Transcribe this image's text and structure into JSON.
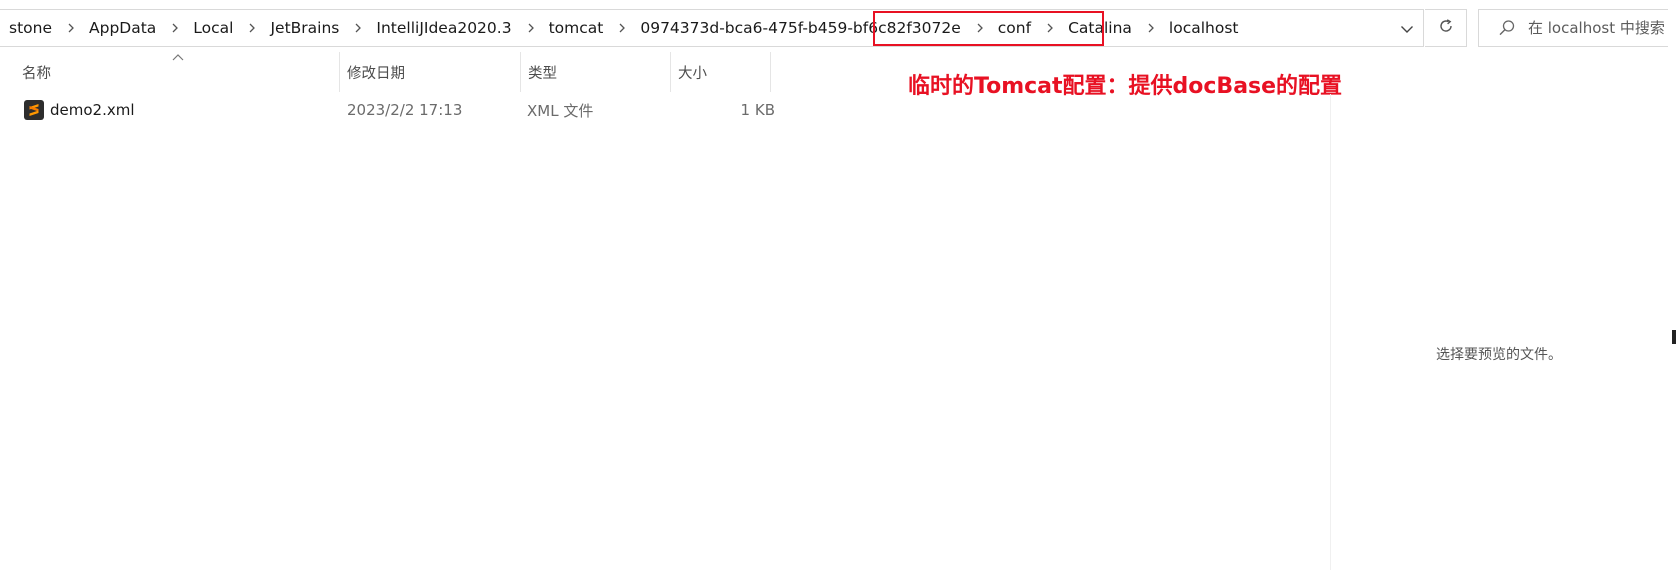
{
  "address_bar": {
    "breadcrumbs": [
      "stone",
      "AppData",
      "Local",
      "JetBrains",
      "IntelliJIdea2020.3",
      "tomcat",
      "0974373d-bca6-475f-b459-bf6c82f3072e",
      "conf",
      "Catalina",
      "localhost"
    ]
  },
  "search": {
    "placeholder": "在 localhost 中搜索"
  },
  "columns": {
    "name": "名称",
    "date": "修改日期",
    "type": "类型",
    "size": "大小"
  },
  "files": [
    {
      "name": "demo2.xml",
      "date": "2023/2/2 17:13",
      "type": "XML 文件",
      "size": "1 KB"
    }
  ],
  "annotation": {
    "text": "临时的Tomcat配置：提供docBase的配置",
    "color": "#e81123"
  },
  "preview": {
    "empty_text": "选择要预览的文件。"
  },
  "icons": {
    "separator": "chevron-right-icon",
    "dropdown": "chevron-down-icon",
    "refresh": "refresh-icon",
    "search": "search-icon",
    "file": "sublime-text-file-icon"
  }
}
